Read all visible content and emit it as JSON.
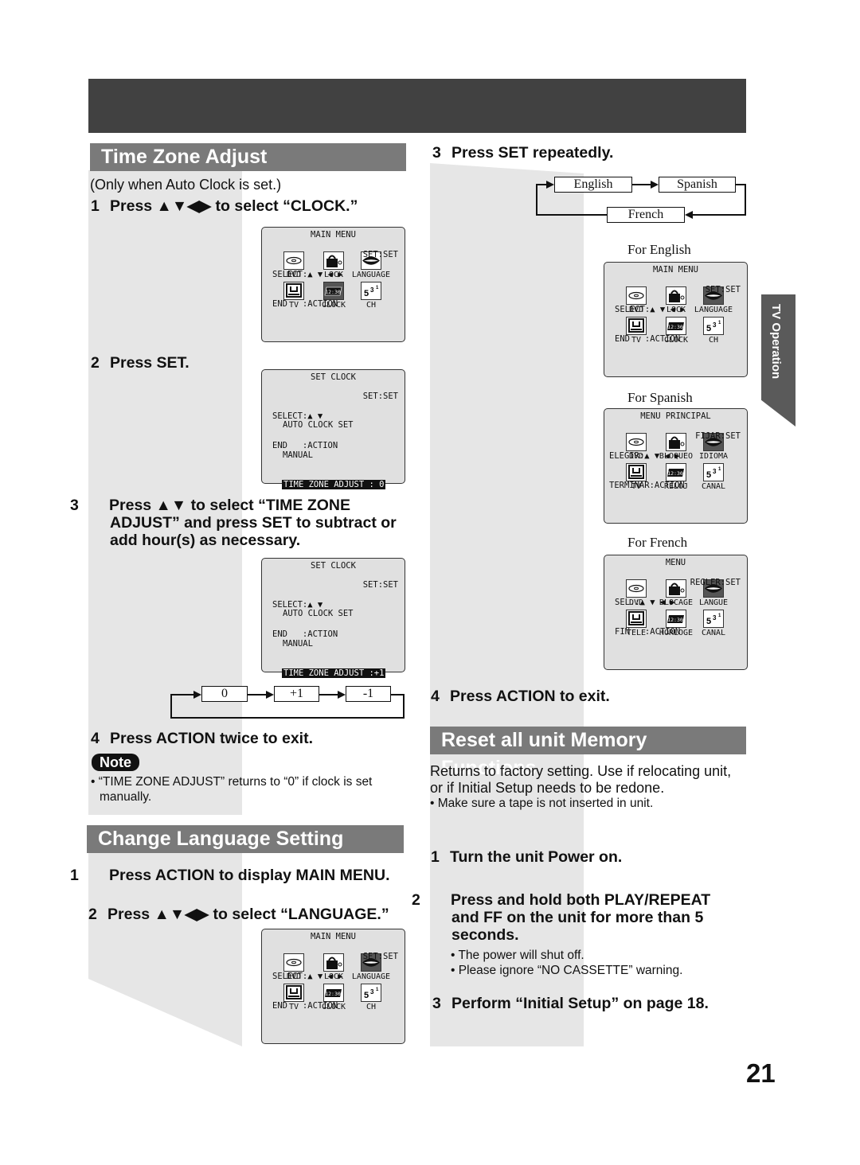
{
  "page": {
    "side_tab": "TV Operation",
    "page_number": "21"
  },
  "time_zone": {
    "title": "Time Zone Adjust",
    "condition": "(Only when Auto Clock is set.)",
    "step1": {
      "num": "1",
      "text": "Press ▲▼◀▶ to select “CLOCK.”"
    },
    "step2": {
      "num": "2",
      "text": "Press SET."
    },
    "step3": {
      "num": "3",
      "text": "Press ▲▼ to select “TIME ZONE ADJUST” and press SET to subtract or add hour(s) as necessary."
    },
    "step4": {
      "num": "4",
      "text": "Press ACTION twice to exit."
    },
    "note_label": "Note",
    "note_text": "• “TIME ZONE ADJUST” returns to “0” if clock is set manually.",
    "cycle": [
      "0",
      "+1",
      "-1"
    ]
  },
  "osd_main_clock": {
    "title": "MAIN MENU",
    "icons": [
      {
        "label": "DVD",
        "icon": "disc-icon"
      },
      {
        "label": "LOCK",
        "icon": "lock-icon"
      },
      {
        "label": "LANGUAGE",
        "icon": "lips-icon"
      },
      {
        "label": "TV",
        "icon": "tv-icon"
      },
      {
        "label": "CLOCK",
        "icon": "clock-icon",
        "selected": true
      },
      {
        "label": "CH",
        "icon": "channel-icon"
      }
    ],
    "foot_left1": "SELECT:▲ ▼ ◀ ▶",
    "foot_right1": "SET:SET",
    "foot_left2": "END   :ACTION",
    "clock_digits": "12:30",
    "ch_digits": "5 3 1"
  },
  "osd_set_clock_0": {
    "title": "SET CLOCK",
    "items": [
      "AUTO CLOCK SET",
      "MANUAL"
    ],
    "highlight": "TIME ZONE ADJUST : 0",
    "foot_left1": "SELECT:▲ ▼",
    "foot_right1": "SET:SET",
    "foot_left2": "END   :ACTION"
  },
  "osd_set_clock_1": {
    "title": "SET CLOCK",
    "items": [
      "AUTO CLOCK SET",
      "MANUAL"
    ],
    "highlight": "TIME ZONE ADJUST :+1",
    "foot_left1": "SELECT:▲ ▼",
    "foot_right1": "SET:SET",
    "foot_left2": "END   :ACTION"
  },
  "language": {
    "title": "Change Language Setting",
    "step1": {
      "num": "1",
      "text": "Press ACTION to display MAIN MENU."
    },
    "step2": {
      "num": "2",
      "text": "Press ▲▼◀▶ to select “LANGUAGE.”"
    },
    "step3": {
      "num": "3",
      "text": "Press SET repeatedly."
    },
    "step4": {
      "num": "4",
      "text": "Press ACTION to exit."
    },
    "cycle": [
      "English",
      "Spanish",
      "French"
    ],
    "caption_en": "For English",
    "caption_es": "For Spanish",
    "caption_fr": "For French"
  },
  "osd_main_lang": {
    "title": "MAIN MENU",
    "icons": [
      {
        "label": "DVD"
      },
      {
        "label": "LOCK"
      },
      {
        "label": "LANGUAGE",
        "selected": true
      },
      {
        "label": "TV"
      },
      {
        "label": "CLOCK"
      },
      {
        "label": "CH"
      }
    ],
    "foot_left1": "SELECT:▲ ▼ ◀ ▶",
    "foot_right1": "SET:SET",
    "foot_left2": "END   :ACTION"
  },
  "osd_spanish": {
    "title": "MENU PRINCIPAL",
    "icons": [
      {
        "label": "DVD"
      },
      {
        "label": "BLOQUEO"
      },
      {
        "label": "IDIOMA",
        "selected": true
      },
      {
        "label": "TV"
      },
      {
        "label": "RELOJ"
      },
      {
        "label": "CANAL"
      }
    ],
    "foot_left1": "ELEGIR:▲ ▼ ◀ ▶",
    "foot_right1": "FIJAR:SET",
    "foot_left2": "TERMINAR:ACTION"
  },
  "osd_french": {
    "title": "MENU",
    "icons": [
      {
        "label": "DVD"
      },
      {
        "label": "BLOCAGE"
      },
      {
        "label": "LANGUE",
        "selected": true
      },
      {
        "label": "TELE"
      },
      {
        "label": "HORLOGE"
      },
      {
        "label": "CANAL"
      }
    ],
    "foot_left1": "SEL.:▲ ▼ ◀ ▶",
    "foot_right1": "REGLER:SET",
    "foot_left2": "FIN   :ACTION"
  },
  "reset": {
    "title": "Reset all unit Memory Functions",
    "intro": "Returns to factory setting. Use if relocating unit, or if Initial Setup needs to be redone.",
    "bullet": "• Make sure a tape is not inserted in unit.",
    "step1": {
      "num": "1",
      "text": "Turn the unit Power on."
    },
    "step2": {
      "num": "2",
      "text": "Press and hold both PLAY/REPEAT and FF on the unit for more than 5 seconds."
    },
    "step2_bullets": [
      "• The power will shut off.",
      "• Please ignore “NO CASSETTE” warning."
    ],
    "step3": {
      "num": "3",
      "text": "Perform “Initial Setup” on page 18."
    }
  }
}
